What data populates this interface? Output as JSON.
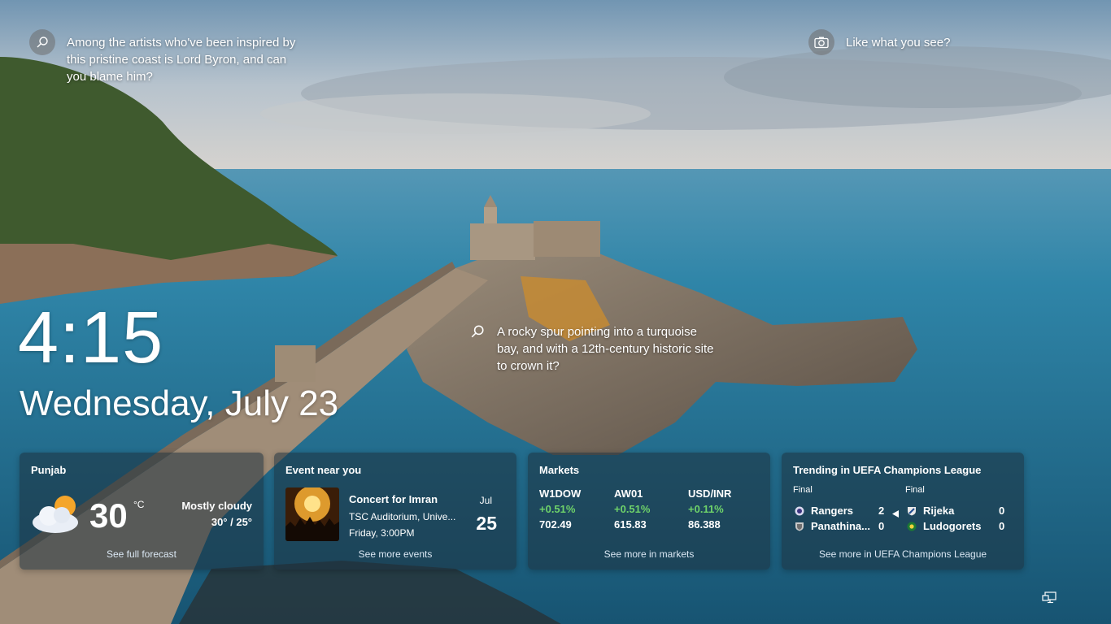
{
  "spotlight": {
    "tip_top": "Among the artists who've been inspired by this pristine coast is Lord Byron, and can you blame him?",
    "like_text": "Like what you see?",
    "tip_middle": "A rocky spur pointing into a turquoise bay, and with a 12th-century historic site to crown it?"
  },
  "clock": {
    "time": "4:15",
    "date": "Wednesday, July 23"
  },
  "weather": {
    "title": "Punjab",
    "icon": "partly-cloudy-icon",
    "temp": "30",
    "unit": "°C",
    "condition": "Mostly cloudy",
    "range": "30° / 25°",
    "more": "See full forecast"
  },
  "event": {
    "title": "Event near you",
    "name": "Concert for Imran",
    "venue": "TSC Auditorium, Unive...",
    "when": "Friday, 3:00PM",
    "month": "Jul",
    "day": "25",
    "more": "See more events"
  },
  "markets": {
    "title": "Markets",
    "items": [
      {
        "symbol": "W1DOW",
        "change": "+0.51%",
        "value": "702.49"
      },
      {
        "symbol": "AW01",
        "change": "+0.51%",
        "value": "615.83"
      },
      {
        "symbol": "USD/INR",
        "change": "+0.11%",
        "value": "86.388"
      }
    ],
    "up_color": "#6fd36a",
    "more": "See more in markets"
  },
  "sports": {
    "title": "Trending in UEFA Champions League",
    "matches": [
      {
        "status": "Final",
        "home": "Rangers",
        "home_score": "2",
        "away": "Panathina...",
        "away_score": "0"
      },
      {
        "status": "Final",
        "home": "Rijeka",
        "home_score": "0",
        "away": "Ludogorets",
        "away_score": "0"
      }
    ],
    "more": "See more in UEFA Champions League"
  },
  "system": {
    "network_icon": "network-monitor-icon"
  }
}
